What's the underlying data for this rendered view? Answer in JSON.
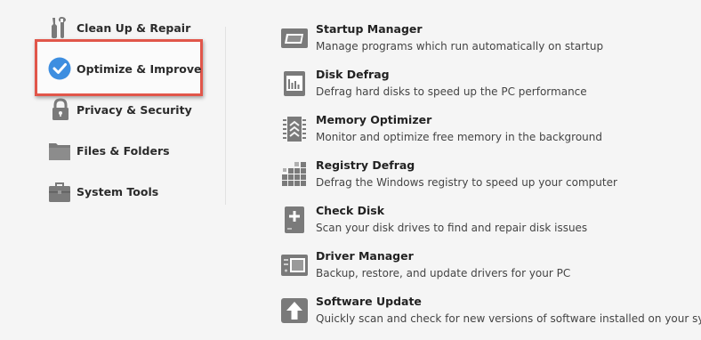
{
  "sidebar": {
    "items": [
      {
        "label": "Clean Up & Repair",
        "icon": "wrench-brush-icon"
      },
      {
        "label": "Optimize & Improve",
        "icon": "checkmark-circle-icon",
        "selected": true
      },
      {
        "label": "Privacy & Security",
        "icon": "padlock-icon"
      },
      {
        "label": "Files & Folders",
        "icon": "folder-icon"
      },
      {
        "label": "System Tools",
        "icon": "toolbox-icon"
      }
    ]
  },
  "tools": [
    {
      "title": "Startup Manager",
      "desc": "Manage programs which run automatically on startup",
      "icon": "startup-window-icon"
    },
    {
      "title": "Disk Defrag",
      "desc": "Defrag hard disks to speed up the PC performance",
      "icon": "disk-defrag-icon"
    },
    {
      "title": "Memory Optimizer",
      "desc": "Monitor and optimize free memory in the background",
      "icon": "memory-chip-icon"
    },
    {
      "title": "Registry Defrag",
      "desc": "Defrag the Windows registry to speed up your computer",
      "icon": "registry-blocks-icon"
    },
    {
      "title": "Check Disk",
      "desc": "Scan your disk drives to find and repair disk issues",
      "icon": "check-disk-plus-icon"
    },
    {
      "title": "Driver Manager",
      "desc": "Backup, restore, and update drivers for your PC",
      "icon": "driver-device-icon"
    },
    {
      "title": "Software Update",
      "desc": "Quickly scan and check for new versions of software installed on your system",
      "icon": "upload-arrow-icon"
    }
  ],
  "colors": {
    "highlight": "#e1564a",
    "check_blue": "#3d8ee0",
    "icon_gray": "#7a7a7a"
  }
}
